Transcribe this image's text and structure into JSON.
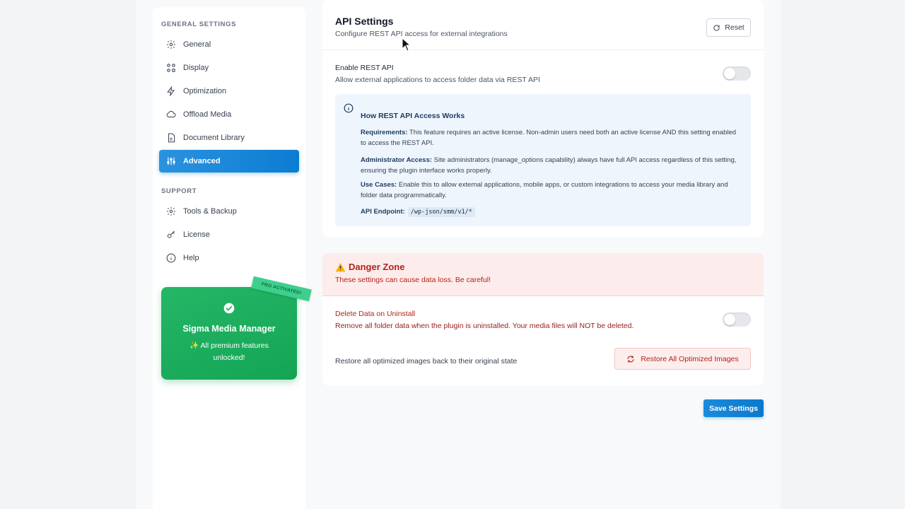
{
  "sidebar": {
    "general_heading": "GENERAL SETTINGS",
    "items": [
      {
        "label": "General",
        "icon": "gear-icon"
      },
      {
        "label": "Display",
        "icon": "grid-icon"
      },
      {
        "label": "Optimization",
        "icon": "lightning-icon"
      },
      {
        "label": "Offload Media",
        "icon": "cloud-icon"
      },
      {
        "label": "Document Library",
        "icon": "document-icon"
      },
      {
        "label": "Advanced",
        "icon": "sliders-icon",
        "active": true
      }
    ],
    "support_heading": "SUPPORT",
    "support_items": [
      {
        "label": "Tools & Backup",
        "icon": "gear-icon"
      },
      {
        "label": "License",
        "icon": "key-icon"
      },
      {
        "label": "Help",
        "icon": "info-icon"
      }
    ],
    "promo": {
      "ribbon": "PRO ACTIVATED!",
      "title": "Sigma Media Manager",
      "desc": "✨ All premium features unlocked!",
      "color": "#1fb05f"
    }
  },
  "api": {
    "title": "API Settings",
    "subtitle": "Configure REST API access for external integrations",
    "reset_label": "Reset",
    "enable_label": "Enable REST API",
    "enable_desc": "Allow external applications to access folder data via REST API",
    "enabled": false,
    "info": {
      "title": "How REST API Access Works",
      "requirements_label": "Requirements:",
      "requirements_text": "This feature requires an active license. Non-admin users need both an active license AND this setting enabled to access the REST API.",
      "admin_label": "Administrator Access:",
      "admin_text": "Site administrators (manage_options capability) always have full API access regardless of this setting, ensuring the plugin interface works properly.",
      "usecases_label": "Use Cases:",
      "usecases_text": "Enable this to allow external applications, mobile apps, or custom integrations to access your media library and folder data programmatically.",
      "endpoint_label": "API Endpoint:",
      "endpoint_value": "/wp-json/smm/v1/*"
    }
  },
  "danger": {
    "title": "Danger Zone",
    "subtitle": "These settings can cause data loss. Be careful!",
    "delete_label": "Delete Data on Uninstall",
    "delete_desc": "Remove all folder data when the plugin is uninstalled. Your media files will NOT be deleted.",
    "delete_enabled": false,
    "restore_desc": "Restore all optimized images back to their original state",
    "restore_button": "Restore All Optimized Images",
    "color": "#b42318"
  },
  "save_label": "Save Settings",
  "accent": "#0c7cd2"
}
